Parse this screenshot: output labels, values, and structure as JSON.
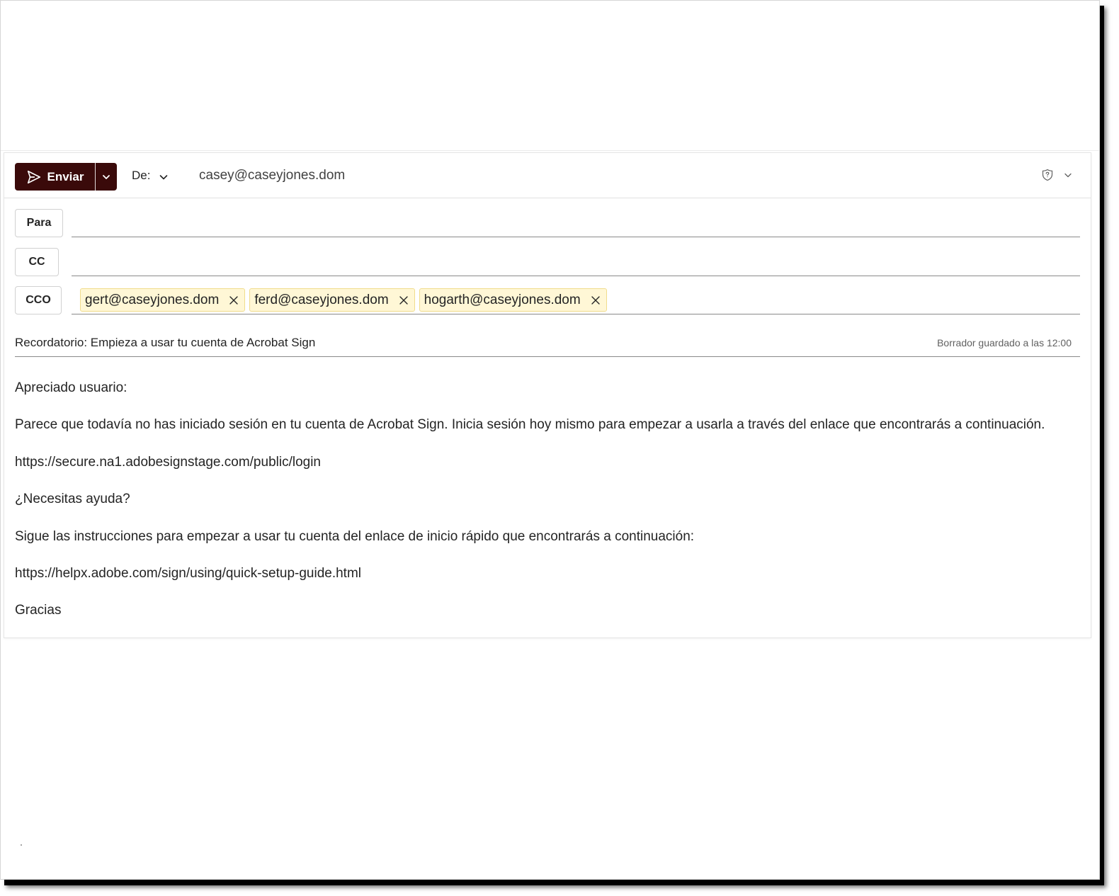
{
  "colors": {
    "send_button": "#3a0a0a",
    "chip_background": "#fff7d6",
    "chip_border": "#f0dc8c",
    "field_underline": "#8a8a8a"
  },
  "toolbar": {
    "send_label": "Enviar",
    "send_icon": "paper-plane-icon",
    "send_dropdown_icon": "chevron-down-icon",
    "from_label": "De:",
    "from_address": "casey@caseyjones.dom",
    "sensitivity_icon": "shield-question-icon",
    "more_icon": "chevron-down-icon"
  },
  "recipients": {
    "to": {
      "label": "Para",
      "chips": []
    },
    "cc": {
      "label": "CC",
      "chips": []
    },
    "bcc": {
      "label": "CCO",
      "chips": [
        "gert@caseyjones.dom",
        "ferd@caseyjones.dom",
        "hogarth@caseyjones.dom"
      ]
    }
  },
  "subject": {
    "text": "Recordatorio: Empieza a usar tu cuenta de Acrobat Sign",
    "draft_status": "Borrador guardado a las 12:00"
  },
  "body": {
    "paragraphs": [
      "Apreciado usuario:",
      "Parece que todavía no has iniciado sesión en tu cuenta de Acrobat Sign. Inicia sesión hoy mismo para empezar a usarla a través del enlace que encontrarás a continuación.",
      "https://secure.na1.adobesignstage.com/public/login",
      "¿Necesitas ayuda?",
      "Sigue las instrucciones para empezar a usar tu cuenta del enlace de inicio rápido que encontrarás a continuación:",
      "https://helpx.adobe.com/sign/using/quick-setup-guide.html",
      "Gracias"
    ]
  }
}
